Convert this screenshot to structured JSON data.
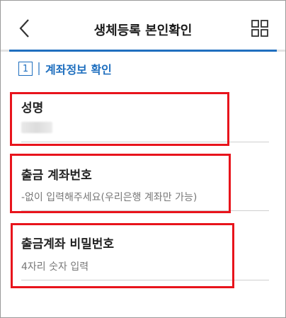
{
  "header": {
    "title": "생체등록 본인확인"
  },
  "step": {
    "number": "1",
    "label": "계좌정보 확인"
  },
  "fields": [
    {
      "label": "성명",
      "value": ""
    },
    {
      "label": "출금 계좌번호",
      "placeholder": "-없이 입력해주세요(우리은행 계좌만 가능)"
    },
    {
      "label": "출금계좌 비밀번호",
      "placeholder": "4자리 숫자 입력"
    }
  ],
  "colors": {
    "accent": "#1f6fbf",
    "highlight": "#e8141c"
  },
  "icons": {
    "back": "back-chevron-icon",
    "menu": "grid-menu-icon"
  }
}
